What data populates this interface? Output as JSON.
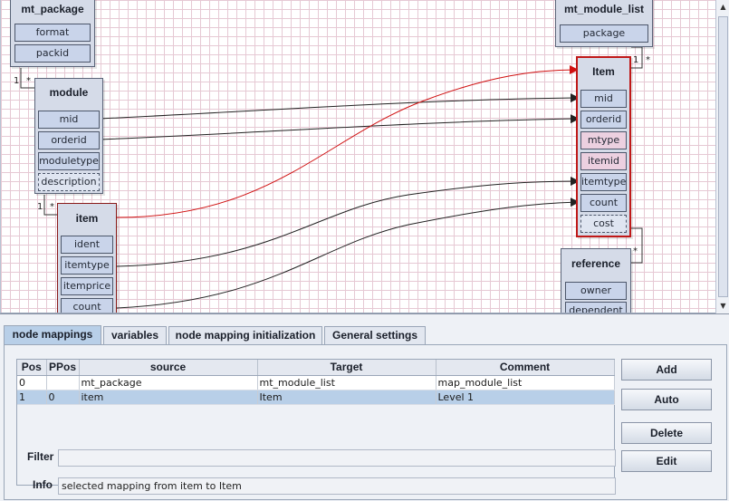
{
  "diagram": {
    "nodes": {
      "mt_package": {
        "title": "mt_package",
        "attrs": [
          "format",
          "packid"
        ]
      },
      "module": {
        "title": "module",
        "attrs": [
          "mid",
          "orderid",
          "moduletype",
          "description"
        ]
      },
      "item": {
        "title": "item",
        "attrs": [
          "ident",
          "itemtype",
          "itemprice",
          "count"
        ]
      },
      "mt_module_list": {
        "title": "mt_module_list",
        "attrs": [
          "package"
        ]
      },
      "Item": {
        "title": "Item",
        "attrs": [
          "mid",
          "orderid",
          "mtype",
          "itemid",
          "itemtype",
          "count",
          "cost"
        ]
      },
      "reference": {
        "title": "reference",
        "attrs": [
          "owner",
          "dependent"
        ]
      }
    },
    "cardinalities": {
      "mt_package_module": "1",
      "mt_package_module_many": "*",
      "module_item": "1",
      "module_item_many": "*",
      "mt_module_list_Item_one": "1",
      "mt_module_list_Item_many": "*",
      "reference_many": "*"
    },
    "colors": {
      "selected_mapping": "#d01010",
      "mapping": "#222222"
    }
  },
  "tabs": [
    "node mappings",
    "variables",
    "node mapping initialization",
    "General settings"
  ],
  "table": {
    "columns": [
      "Pos",
      "PPos",
      "source",
      "Target",
      "Comment"
    ],
    "rows": [
      [
        "0",
        "",
        "mt_package",
        "mt_module_list",
        "map_module_list"
      ],
      [
        "1",
        "0",
        "item",
        "Item",
        "Level 1"
      ]
    ]
  },
  "buttons": {
    "add": "Add",
    "auto": "Auto",
    "delete": "Delete",
    "edit": "Edit"
  },
  "filter": {
    "label": "Filter",
    "value": ""
  },
  "info": {
    "label": "Info",
    "value": "selected mapping from item to Item"
  }
}
